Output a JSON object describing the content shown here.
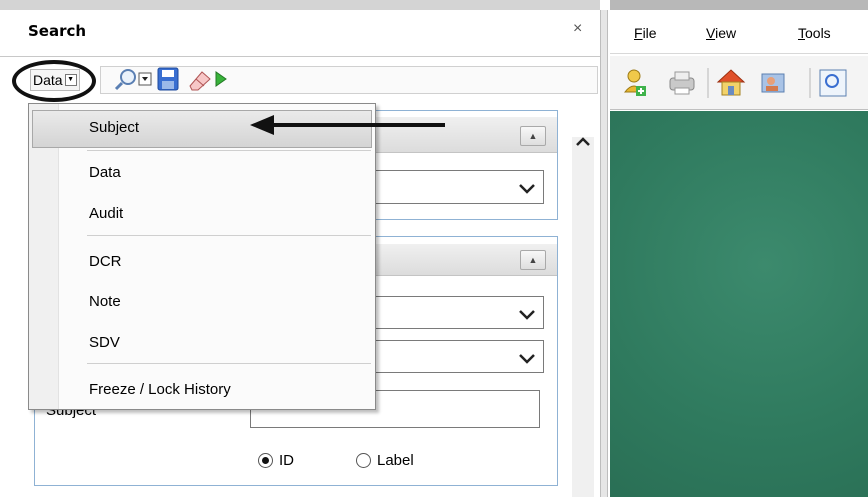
{
  "search_pane": {
    "title": "Search",
    "close_glyph": "×",
    "data_dropdown_value": "Data",
    "subject_label": "Subject",
    "radio_id_label": "ID",
    "radio_label_label": "Label",
    "radio_selected": "ID"
  },
  "dropdown_menu": {
    "items": [
      "Subject",
      "Data",
      "Audit",
      "DCR",
      "Note",
      "SDV",
      "Freeze / Lock History"
    ],
    "highlighted": "Subject"
  },
  "app": {
    "menu": [
      {
        "accel": "F",
        "rest": "ile"
      },
      {
        "accel": "V",
        "rest": "iew"
      },
      {
        "accel": "T",
        "rest": "ools"
      }
    ],
    "background_color": "#2f7a5e"
  },
  "icons": [
    "zoom-search-icon",
    "save-icon",
    "eraser-icon",
    "run-icon",
    "add-user-icon",
    "print-icon",
    "home-icon",
    "user-card-icon",
    "find-icon",
    "close-icon",
    "chevron-down-icon",
    "scroll-up-icon",
    "collapse-up-icon"
  ],
  "colors": {
    "groupbox_border": "#8fb2d4",
    "callout": "#111111"
  }
}
